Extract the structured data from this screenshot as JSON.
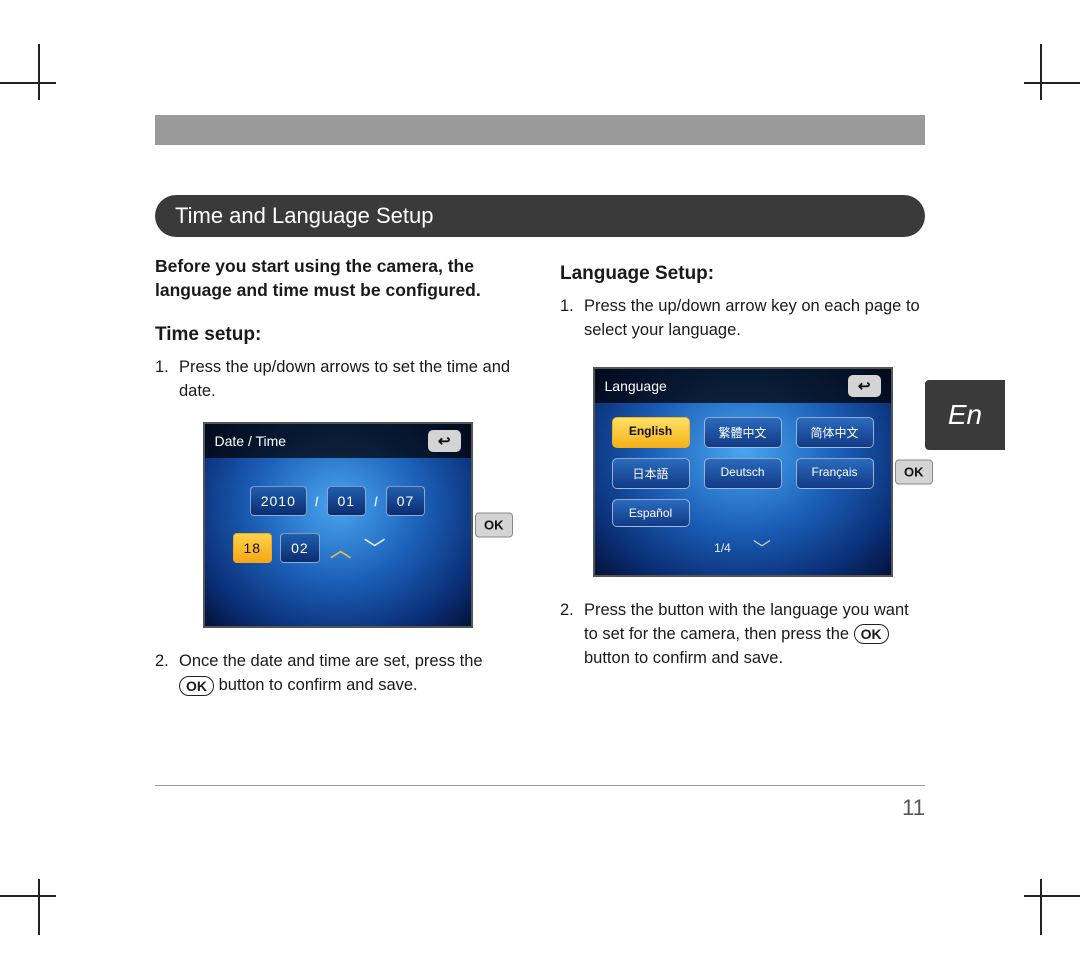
{
  "section_title": "Time and Language Setup",
  "intro": "Before you start using the camera, the language and time must be configured.",
  "left": {
    "heading": "Time setup:",
    "step1": "Press the up/down arrows to set the time and date.",
    "step2a": "Once the date and time are set, press the ",
    "step2b": " button to confirm and save."
  },
  "right": {
    "heading": "Language Setup:",
    "step1": "Press the up/down arrow key on each page to select your language.",
    "step2a": "Press the button with the language you want to set for the camera, then press the ",
    "step2b": " button to confirm and save."
  },
  "ok_label": "OK",
  "lang_tab": "En",
  "page_number": "11",
  "datetime_screen": {
    "title": "Date / Time",
    "back_glyph": "↩",
    "year": "2010",
    "month": "01",
    "day": "07",
    "hour": "18",
    "minute": "02",
    "ok": "OK"
  },
  "language_screen": {
    "title": "Language",
    "back_glyph": "↩",
    "options": [
      "English",
      "繁體中文",
      "简体中文",
      "日本語",
      "Deutsch",
      "Français",
      "Español"
    ],
    "selected_index": 0,
    "page_indicator": "1/4",
    "ok": "OK"
  }
}
